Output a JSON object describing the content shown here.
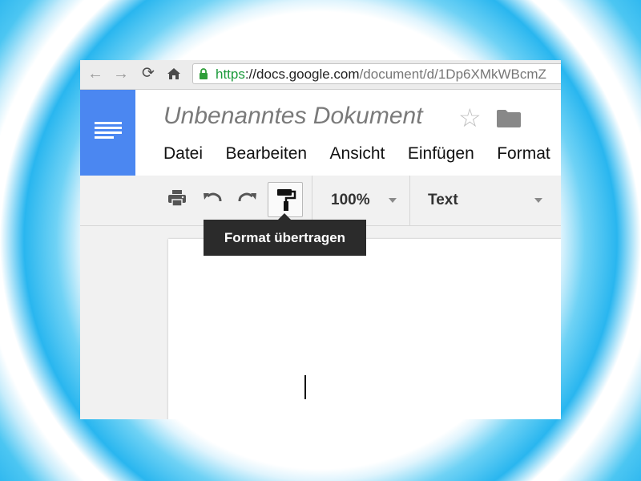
{
  "browser": {
    "url_scheme": "https",
    "url_separator": "://",
    "url_host": "docs.google.com",
    "url_path": "/document/d/1Dp6XMkWBcmZ",
    "icons": [
      "back-icon",
      "forward-icon",
      "reload-icon",
      "home-icon",
      "lock-icon"
    ]
  },
  "docs": {
    "title": "Unbenanntes Dokument",
    "menu": [
      "Datei",
      "Bearbeiten",
      "Ansicht",
      "Einfügen",
      "Format"
    ]
  },
  "toolbar": {
    "zoom": "100%",
    "style": "Text",
    "tooltip": "Format übertragen",
    "icons": [
      "print-icon",
      "undo-icon",
      "redo-icon",
      "paint-format-icon"
    ]
  },
  "colors": {
    "docs_blue": "#4b87f1",
    "url_green": "#1a9a3a",
    "background_cyan": "#1aaeec"
  }
}
